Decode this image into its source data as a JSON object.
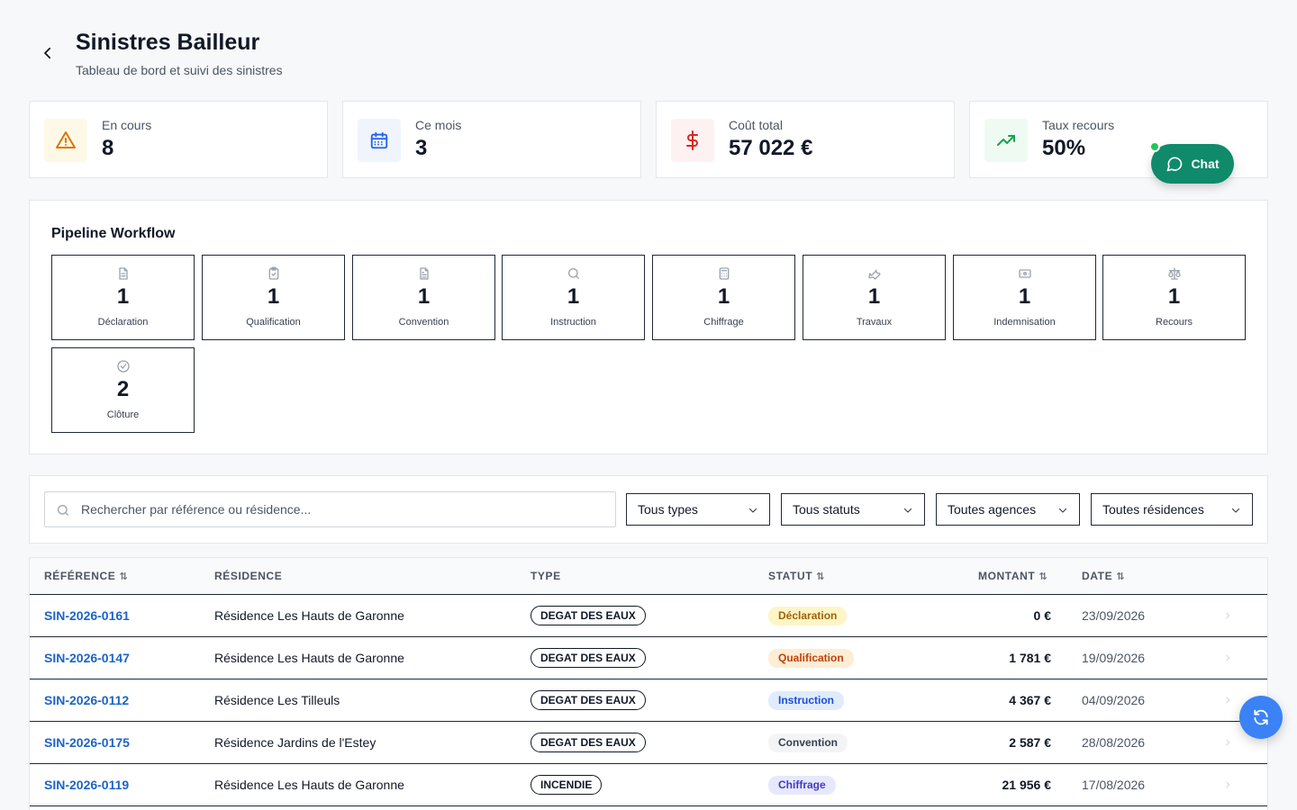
{
  "header": {
    "title": "Sinistres Bailleur",
    "subtitle": "Tableau de bord et suivi des sinistres"
  },
  "stats": [
    {
      "label": "En cours",
      "value": "8",
      "icon": "warning-icon",
      "icon_color": "#d97706",
      "icon_bg": "#fef9e7"
    },
    {
      "label": "Ce mois",
      "value": "3",
      "icon": "calendar-icon",
      "icon_color": "#2563eb",
      "icon_bg": "#eff4fd"
    },
    {
      "label": "Coût total",
      "value": "57 022 €",
      "icon": "dollar-icon",
      "icon_color": "#dc2626",
      "icon_bg": "#fdf1f1"
    },
    {
      "label": "Taux recours",
      "value": "50%",
      "icon": "trending-up-icon",
      "icon_color": "#16a34a",
      "icon_bg": "#effaf3"
    }
  ],
  "chat": {
    "label": "Chat"
  },
  "pipeline": {
    "title": "Pipeline Workflow",
    "stages": [
      {
        "label": "Déclaration",
        "count": "1",
        "icon": "file-icon"
      },
      {
        "label": "Qualification",
        "count": "1",
        "icon": "clipboard-check-icon"
      },
      {
        "label": "Convention",
        "count": "1",
        "icon": "file-text-icon"
      },
      {
        "label": "Instruction",
        "count": "1",
        "icon": "search-icon"
      },
      {
        "label": "Chiffrage",
        "count": "1",
        "icon": "calculator-icon"
      },
      {
        "label": "Travaux",
        "count": "1",
        "icon": "wrench-icon"
      },
      {
        "label": "Indemnisation",
        "count": "1",
        "icon": "banknote-icon"
      },
      {
        "label": "Recours",
        "count": "1",
        "icon": "scale-icon"
      },
      {
        "label": "Clôture",
        "count": "2",
        "icon": "check-circle-icon"
      }
    ]
  },
  "filters": {
    "search_placeholder": "Rechercher par référence ou résidence...",
    "type": "Tous types",
    "status": "Tous statuts",
    "agency": "Toutes agences",
    "residence": "Toutes résidences"
  },
  "table": {
    "columns": {
      "reference": "RÉFÉRENCE",
      "residence": "RÉSIDENCE",
      "type": "TYPE",
      "status": "STATUT",
      "amount": "MONTANT",
      "date": "DATE"
    },
    "sort_glyph": "⇅",
    "rows": [
      {
        "reference": "SIN-2026-0161",
        "residence": "Résidence Les Hauts de Garonne",
        "type": "DEGAT DES EAUX",
        "status": "Déclaration",
        "status_bg": "#fef5c7",
        "status_color": "#a16207",
        "amount": "0 €",
        "date": "23/09/2026"
      },
      {
        "reference": "SIN-2026-0147",
        "residence": "Résidence Les Hauts de Garonne",
        "type": "DEGAT DES EAUX",
        "status": "Qualification",
        "status_bg": "#feedd5",
        "status_color": "#c2410c",
        "amount": "1 781 €",
        "date": "19/09/2026"
      },
      {
        "reference": "SIN-2026-0112",
        "residence": "Résidence Les Tilleuls",
        "type": "DEGAT DES EAUX",
        "status": "Instruction",
        "status_bg": "#e0ecfd",
        "status_color": "#1d4ed8",
        "amount": "4 367 €",
        "date": "04/09/2026"
      },
      {
        "reference": "SIN-2026-0175",
        "residence": "Résidence Jardins de l'Estey",
        "type": "DEGAT DES EAUX",
        "status": "Convention",
        "status_bg": "#f3f4f6",
        "status_color": "#374151",
        "amount": "2 587 €",
        "date": "28/08/2026"
      },
      {
        "reference": "SIN-2026-0119",
        "residence": "Résidence Les Hauts de Garonne",
        "type": "INCENDIE",
        "status": "Chiffrage",
        "status_bg": "#e6e9fb",
        "status_color": "#4338ca",
        "amount": "21 956 €",
        "date": "17/08/2026"
      }
    ]
  }
}
